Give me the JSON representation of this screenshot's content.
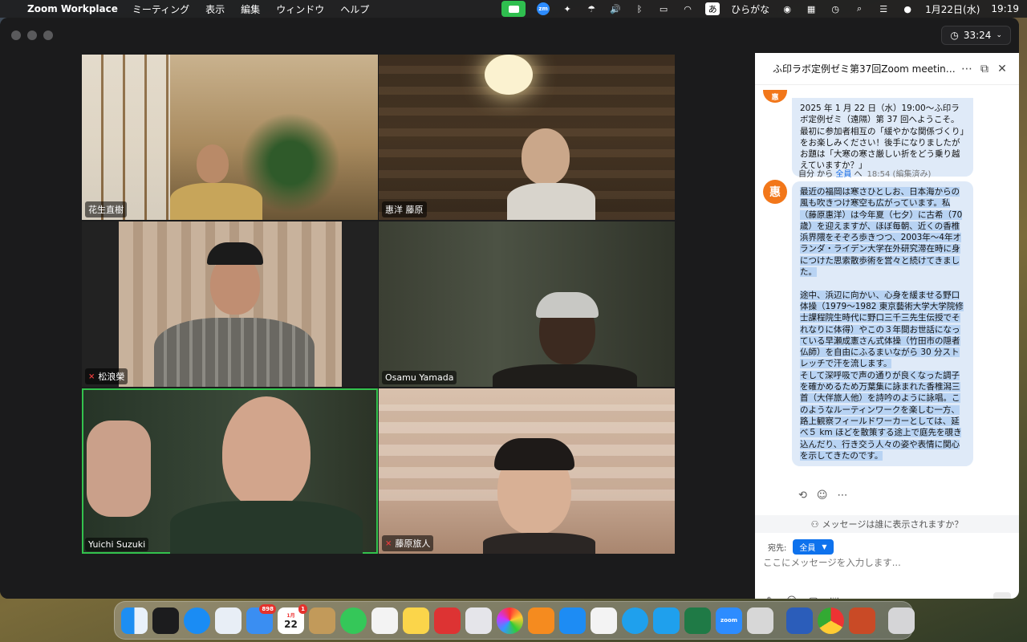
{
  "menubar": {
    "app_name": "Zoom Workplace",
    "menus": [
      "ミーティング",
      "表示",
      "編集",
      "ウィンドウ",
      "ヘルプ"
    ],
    "input_mode": "ひらがな",
    "input_glyph": "あ",
    "date": "1月22日(水)",
    "time": "19:19",
    "zoom_icon_text": "zm"
  },
  "meeting": {
    "timer": "33:24"
  },
  "participants": [
    {
      "name": "花生直樹",
      "muted": false
    },
    {
      "name": "惠洋 藤原",
      "muted": false
    },
    {
      "name": "松浪榮",
      "muted": true
    },
    {
      "name": "Osamu Yamada",
      "muted": false
    },
    {
      "name": "Yuichi Suzuki",
      "muted": false,
      "active_speaker": true
    },
    {
      "name": "藤原旅人",
      "muted": true
    }
  ],
  "chat": {
    "title": "ふ印ラボ定例ゼミ第37回Zoom meeting in...",
    "avatar_initial": "惠",
    "prev_message": "2025 年 1 月 22 日（水）19:00～ふ印ラボ定例ゼミ（遠隔）第 37 回へようこそ。最初に参加者相互の「緩やかな関係づくり」をお楽しみください！後手になりましたがお題は「大寒の寒さ厳しい折をどう乗り越えていますか？」",
    "meta_from": "自分 から ",
    "meta_to": "全員",
    "meta_to_suffix": " へ",
    "meta_time": "18:54 (編集済み)",
    "message_p1": "最近の福岡は寒さひとしお、日本海からの風も吹きつけ寒空も広がっています。私（藤原惠洋）は今年夏（七夕）に古希（70歳）を迎えますが、ほぼ毎朝、近くの香椎浜界隈をそぞろ歩きつつ、2003年～4年オランダ・ライデン大学在外研究滞在時に身につけた思索散歩術を営々と続けてきました。",
    "message_p2": "途中、浜辺に向かい、心身を緩ませる野口体操（1979～1982 東京藝術大学大学院修士課程院生時代に野口三千三先生伝授でそれなりに体得）やこの３年間お世話になっている早瀬成憲さん式体操（竹田市の隠者仏師）を自由にふるまいながら 30 分ストレッチで汗を流します。",
    "message_p3": "そして深呼吸で声の通りが良くなった調子を確かめるため万葉集に詠まれた香椎潟三首（大伴旅人他）を詩吟のように詠唱。このようなルーティンワークを楽しむ一方、路上観察フィールドワーカーとしては、延べ５ km ほどを散策する途上で庭先を覗き込んだり、行き交う人々の姿や表情に関心を示してきたのです。",
    "visibility_prompt": "メッセージは誰に表示されますか？",
    "to_label": "宛先:",
    "to_value": "全員",
    "input_placeholder": "ここにメッセージを入力します..."
  },
  "dock": {
    "mail_badge": "898",
    "calendar_badge": "1",
    "calendar_month": "1月",
    "calendar_day": "22",
    "zoom_label": "zoom"
  }
}
